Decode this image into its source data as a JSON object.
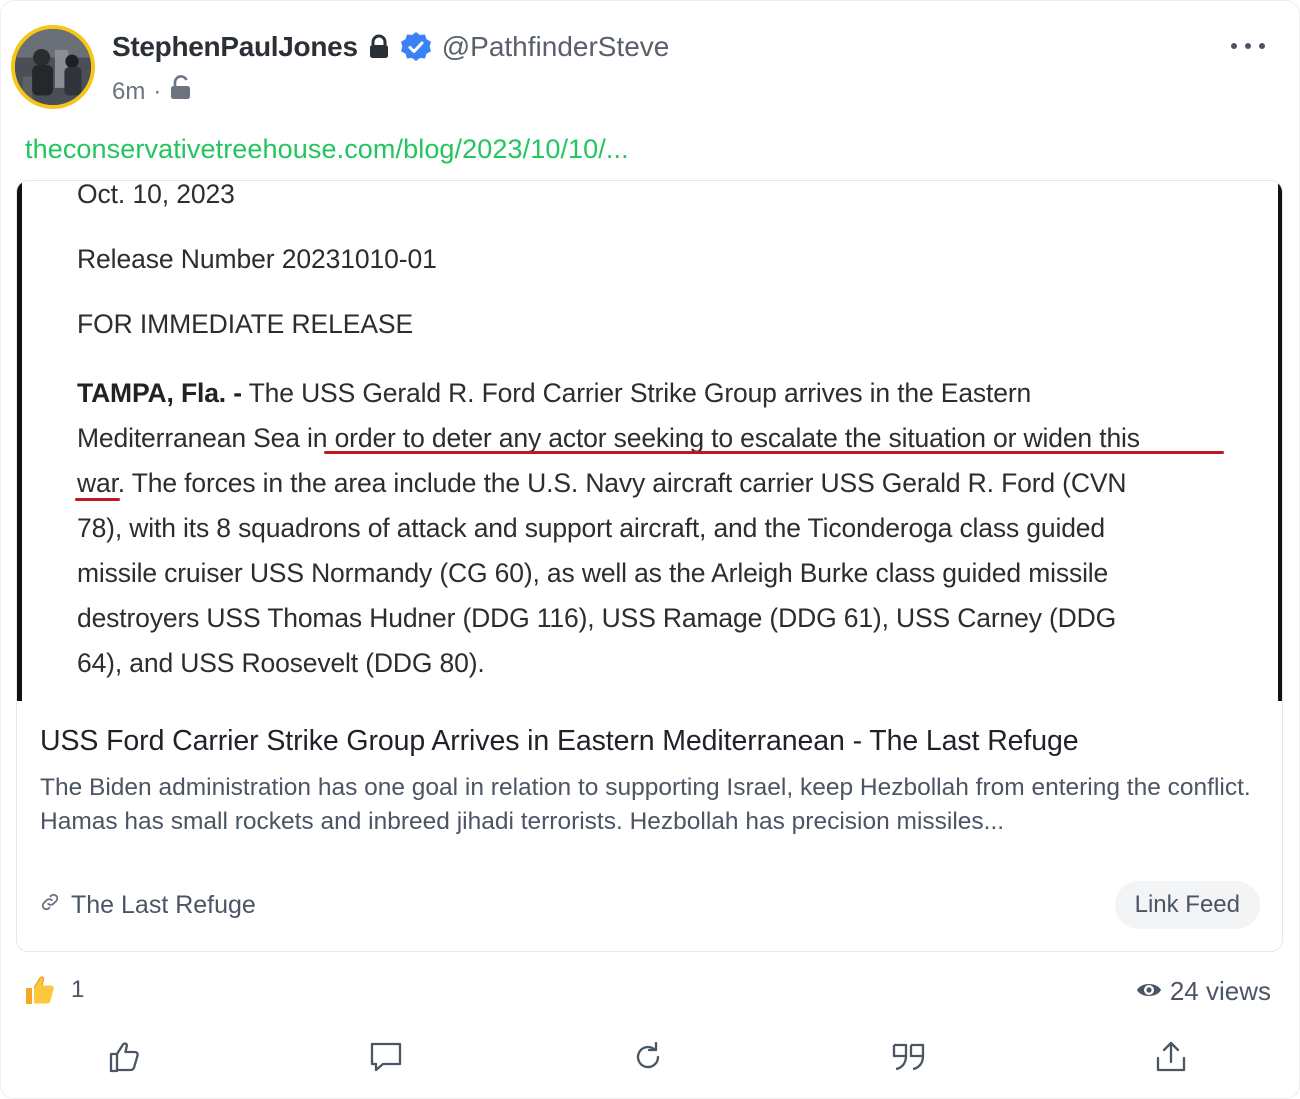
{
  "post": {
    "author": {
      "display_name": "StephenPaulJones",
      "handle": "@PathfinderSteve",
      "verified": true,
      "locked": true
    },
    "timestamp": "6m",
    "separator": "·",
    "visibility_icon": "unlock-icon",
    "link_url_text": "theconservativetreehouse.com/blog/2023/10/10/..."
  },
  "card": {
    "image_text": {
      "date": "Oct. 10, 2023",
      "release_number": "Release Number 20231010-01",
      "release_type": "FOR IMMEDIATE RELEASE",
      "dateline": "TAMPA, Fla. -",
      "lines": [
        "The USS Gerald R. Ford Carrier Strike Group arrives in the Eastern",
        "Mediterranean Sea in order to deter any actor seeking to escalate the situation or widen this",
        "war. The forces in the area include the U.S. Navy aircraft carrier USS Gerald R. Ford (CVN",
        "78), with its 8 squadrons of attack and support aircraft, and the Ticonderoga class guided",
        "missile cruiser USS Normandy (CG 60), as well as the Arleigh Burke class guided missile",
        "destroyers USS Thomas Hudner (DDG 116), USS Ramage (DDG 61), USS Carney (DDG",
        "64), and USS Roosevelt (DDG 80)."
      ],
      "underline_color": "#c4161c"
    },
    "title": "USS Ford Carrier Strike Group Arrives in Eastern Mediterranean - The Last Refuge",
    "description": "The Biden administration has one goal in relation to supporting Israel, keep Hezbollah from entering the conflict. Hamas has small rockets and inbreed jihadi terrorists.  Hezbollah has precision missiles...",
    "source": "The Last Refuge",
    "link_feed_label": "Link Feed"
  },
  "stats": {
    "reaction_count": "1",
    "views": "24 views"
  },
  "actions": [
    "like-icon",
    "reply-icon",
    "repost-icon",
    "quote-icon",
    "share-icon"
  ],
  "colors": {
    "link": "#22c55e",
    "verified": "#3b82f6",
    "avatar_ring": "#f5c518"
  }
}
